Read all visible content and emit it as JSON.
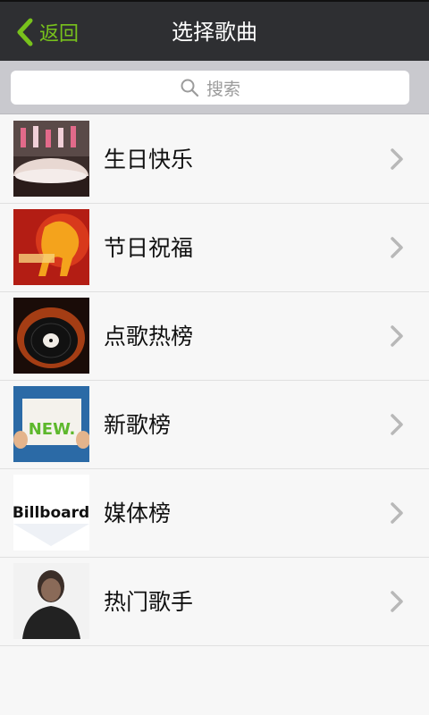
{
  "header": {
    "back_label": "返回",
    "title": "选择歌曲"
  },
  "search": {
    "placeholder": "搜索"
  },
  "list": {
    "items": [
      {
        "label": "生日快乐",
        "thumb": "birthday-cake-photo"
      },
      {
        "label": "节日祝福",
        "thumb": "new-year-horse-poster"
      },
      {
        "label": "点歌热榜",
        "thumb": "flaming-vinyl-record"
      },
      {
        "label": "新歌榜",
        "thumb": "new-sign-board"
      },
      {
        "label": "媒体榜",
        "thumb": "billboard-logo",
        "thumb_text": "Billboard"
      },
      {
        "label": "热门歌手",
        "thumb": "singer-portrait"
      }
    ]
  },
  "colors": {
    "accent": "#78c21c",
    "topbar": "#2e2f32",
    "search_bg": "#c9c9ce"
  }
}
